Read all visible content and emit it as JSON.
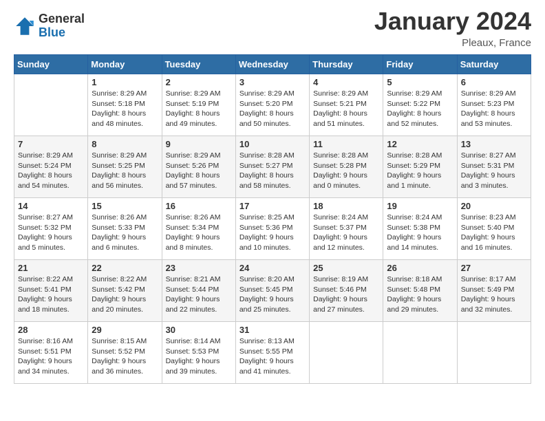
{
  "logo": {
    "general": "General",
    "blue": "Blue"
  },
  "title": "January 2024",
  "location": "Pleaux, France",
  "headers": [
    "Sunday",
    "Monday",
    "Tuesday",
    "Wednesday",
    "Thursday",
    "Friday",
    "Saturday"
  ],
  "weeks": [
    [
      {
        "day": "",
        "sunrise": "",
        "sunset": "",
        "daylight": ""
      },
      {
        "day": "1",
        "sunrise": "Sunrise: 8:29 AM",
        "sunset": "Sunset: 5:18 PM",
        "daylight": "Daylight: 8 hours and 48 minutes."
      },
      {
        "day": "2",
        "sunrise": "Sunrise: 8:29 AM",
        "sunset": "Sunset: 5:19 PM",
        "daylight": "Daylight: 8 hours and 49 minutes."
      },
      {
        "day": "3",
        "sunrise": "Sunrise: 8:29 AM",
        "sunset": "Sunset: 5:20 PM",
        "daylight": "Daylight: 8 hours and 50 minutes."
      },
      {
        "day": "4",
        "sunrise": "Sunrise: 8:29 AM",
        "sunset": "Sunset: 5:21 PM",
        "daylight": "Daylight: 8 hours and 51 minutes."
      },
      {
        "day": "5",
        "sunrise": "Sunrise: 8:29 AM",
        "sunset": "Sunset: 5:22 PM",
        "daylight": "Daylight: 8 hours and 52 minutes."
      },
      {
        "day": "6",
        "sunrise": "Sunrise: 8:29 AM",
        "sunset": "Sunset: 5:23 PM",
        "daylight": "Daylight: 8 hours and 53 minutes."
      }
    ],
    [
      {
        "day": "7",
        "sunrise": "Sunrise: 8:29 AM",
        "sunset": "Sunset: 5:24 PM",
        "daylight": "Daylight: 8 hours and 54 minutes."
      },
      {
        "day": "8",
        "sunrise": "Sunrise: 8:29 AM",
        "sunset": "Sunset: 5:25 PM",
        "daylight": "Daylight: 8 hours and 56 minutes."
      },
      {
        "day": "9",
        "sunrise": "Sunrise: 8:29 AM",
        "sunset": "Sunset: 5:26 PM",
        "daylight": "Daylight: 8 hours and 57 minutes."
      },
      {
        "day": "10",
        "sunrise": "Sunrise: 8:28 AM",
        "sunset": "Sunset: 5:27 PM",
        "daylight": "Daylight: 8 hours and 58 minutes."
      },
      {
        "day": "11",
        "sunrise": "Sunrise: 8:28 AM",
        "sunset": "Sunset: 5:28 PM",
        "daylight": "Daylight: 9 hours and 0 minutes."
      },
      {
        "day": "12",
        "sunrise": "Sunrise: 8:28 AM",
        "sunset": "Sunset: 5:29 PM",
        "daylight": "Daylight: 9 hours and 1 minute."
      },
      {
        "day": "13",
        "sunrise": "Sunrise: 8:27 AM",
        "sunset": "Sunset: 5:31 PM",
        "daylight": "Daylight: 9 hours and 3 minutes."
      }
    ],
    [
      {
        "day": "14",
        "sunrise": "Sunrise: 8:27 AM",
        "sunset": "Sunset: 5:32 PM",
        "daylight": "Daylight: 9 hours and 5 minutes."
      },
      {
        "day": "15",
        "sunrise": "Sunrise: 8:26 AM",
        "sunset": "Sunset: 5:33 PM",
        "daylight": "Daylight: 9 hours and 6 minutes."
      },
      {
        "day": "16",
        "sunrise": "Sunrise: 8:26 AM",
        "sunset": "Sunset: 5:34 PM",
        "daylight": "Daylight: 9 hours and 8 minutes."
      },
      {
        "day": "17",
        "sunrise": "Sunrise: 8:25 AM",
        "sunset": "Sunset: 5:36 PM",
        "daylight": "Daylight: 9 hours and 10 minutes."
      },
      {
        "day": "18",
        "sunrise": "Sunrise: 8:24 AM",
        "sunset": "Sunset: 5:37 PM",
        "daylight": "Daylight: 9 hours and 12 minutes."
      },
      {
        "day": "19",
        "sunrise": "Sunrise: 8:24 AM",
        "sunset": "Sunset: 5:38 PM",
        "daylight": "Daylight: 9 hours and 14 minutes."
      },
      {
        "day": "20",
        "sunrise": "Sunrise: 8:23 AM",
        "sunset": "Sunset: 5:40 PM",
        "daylight": "Daylight: 9 hours and 16 minutes."
      }
    ],
    [
      {
        "day": "21",
        "sunrise": "Sunrise: 8:22 AM",
        "sunset": "Sunset: 5:41 PM",
        "daylight": "Daylight: 9 hours and 18 minutes."
      },
      {
        "day": "22",
        "sunrise": "Sunrise: 8:22 AM",
        "sunset": "Sunset: 5:42 PM",
        "daylight": "Daylight: 9 hours and 20 minutes."
      },
      {
        "day": "23",
        "sunrise": "Sunrise: 8:21 AM",
        "sunset": "Sunset: 5:44 PM",
        "daylight": "Daylight: 9 hours and 22 minutes."
      },
      {
        "day": "24",
        "sunrise": "Sunrise: 8:20 AM",
        "sunset": "Sunset: 5:45 PM",
        "daylight": "Daylight: 9 hours and 25 minutes."
      },
      {
        "day": "25",
        "sunrise": "Sunrise: 8:19 AM",
        "sunset": "Sunset: 5:46 PM",
        "daylight": "Daylight: 9 hours and 27 minutes."
      },
      {
        "day": "26",
        "sunrise": "Sunrise: 8:18 AM",
        "sunset": "Sunset: 5:48 PM",
        "daylight": "Daylight: 9 hours and 29 minutes."
      },
      {
        "day": "27",
        "sunrise": "Sunrise: 8:17 AM",
        "sunset": "Sunset: 5:49 PM",
        "daylight": "Daylight: 9 hours and 32 minutes."
      }
    ],
    [
      {
        "day": "28",
        "sunrise": "Sunrise: 8:16 AM",
        "sunset": "Sunset: 5:51 PM",
        "daylight": "Daylight: 9 hours and 34 minutes."
      },
      {
        "day": "29",
        "sunrise": "Sunrise: 8:15 AM",
        "sunset": "Sunset: 5:52 PM",
        "daylight": "Daylight: 9 hours and 36 minutes."
      },
      {
        "day": "30",
        "sunrise": "Sunrise: 8:14 AM",
        "sunset": "Sunset: 5:53 PM",
        "daylight": "Daylight: 9 hours and 39 minutes."
      },
      {
        "day": "31",
        "sunrise": "Sunrise: 8:13 AM",
        "sunset": "Sunset: 5:55 PM",
        "daylight": "Daylight: 9 hours and 41 minutes."
      },
      {
        "day": "",
        "sunrise": "",
        "sunset": "",
        "daylight": ""
      },
      {
        "day": "",
        "sunrise": "",
        "sunset": "",
        "daylight": ""
      },
      {
        "day": "",
        "sunrise": "",
        "sunset": "",
        "daylight": ""
      }
    ]
  ]
}
